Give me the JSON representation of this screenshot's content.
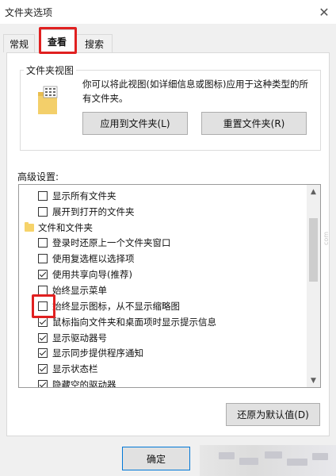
{
  "window": {
    "title": "文件夹选项",
    "close_symbol": "✕"
  },
  "tabs": [
    {
      "label": "常规"
    },
    {
      "label": "查看"
    },
    {
      "label": "搜索"
    }
  ],
  "folder_views": {
    "legend": "文件夹视图",
    "description": "你可以将此视图(如详细信息或图标)应用于这种类型的所有文件夹。",
    "apply_button": "应用到文件夹(L)",
    "reset_button": "重置文件夹(R)"
  },
  "advanced": {
    "label": "高级设置:",
    "items": [
      {
        "type": "checkbox",
        "label": "显示所有文件夹",
        "checked": false,
        "indent": 1
      },
      {
        "type": "checkbox",
        "label": "展开到打开的文件夹",
        "checked": false,
        "indent": 1
      },
      {
        "type": "folder",
        "label": "文件和文件夹",
        "indent": 0
      },
      {
        "type": "checkbox",
        "label": "登录时还原上一个文件夹窗口",
        "checked": false,
        "indent": 1
      },
      {
        "type": "checkbox",
        "label": "使用复选框以选择项",
        "checked": false,
        "indent": 1
      },
      {
        "type": "checkbox",
        "label": "使用共享向导(推荐)",
        "checked": true,
        "indent": 1
      },
      {
        "type": "checkbox",
        "label": "始终显示菜单",
        "checked": false,
        "indent": 1
      },
      {
        "type": "checkbox",
        "label": "始终显示图标，从不显示缩略图",
        "checked": false,
        "indent": 1
      },
      {
        "type": "checkbox",
        "label": "鼠标指向文件夹和桌面项时显示提示信息",
        "checked": true,
        "indent": 1
      },
      {
        "type": "checkbox",
        "label": "显示驱动器号",
        "checked": true,
        "indent": 1
      },
      {
        "type": "checkbox",
        "label": "显示同步提供程序通知",
        "checked": true,
        "indent": 1
      },
      {
        "type": "checkbox",
        "label": "显示状态栏",
        "checked": true,
        "indent": 1
      },
      {
        "type": "checkbox",
        "label": "隐藏空的驱动器",
        "checked": true,
        "indent": 1
      }
    ],
    "scroll_up": "▲",
    "scroll_down": "▼"
  },
  "restore_button": "还原为默认值(D)",
  "footer": {
    "ok_button": "确定"
  },
  "watermark": "com"
}
